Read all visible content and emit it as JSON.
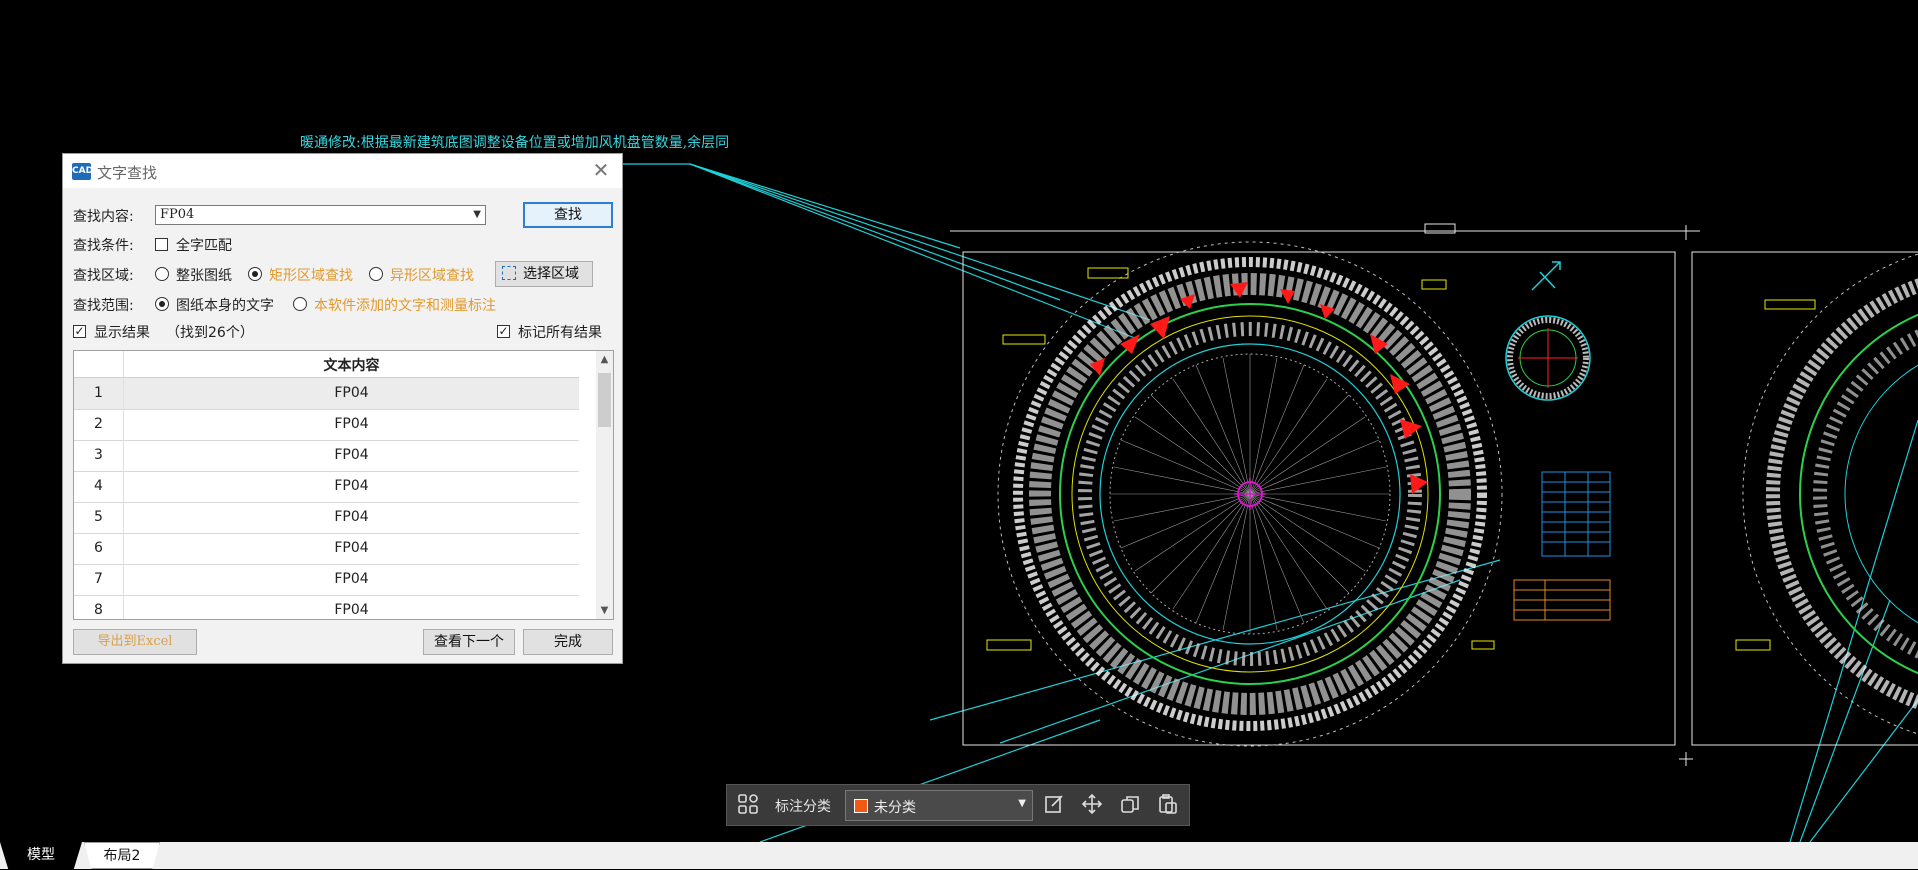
{
  "canvas": {
    "note_text": "暖通修改:根据最新建筑底图调整设备位置或增加风机盘管数量,余层同"
  },
  "dialog": {
    "title": "文字查找",
    "app_icon_text": "CAD",
    "close_glyph": "✕",
    "search_label": "查找内容:",
    "search_value": "FP04",
    "find_button": "查找",
    "condition_label": "查找条件:",
    "whole_word_label": "全字匹配",
    "whole_word_checked": false,
    "area_label": "查找区域:",
    "area_options": [
      "整张图纸",
      "矩形区域查找",
      "异形区域查找"
    ],
    "area_selected": "矩形区域查找",
    "select_area_button": "选择区域",
    "scope_label": "查找范围:",
    "scope_options": [
      "图纸本身的文字",
      "本软件添加的文字和测量标注"
    ],
    "scope_selected": "图纸本身的文字",
    "show_results_label": "显示结果",
    "show_results_checked": true,
    "found_count_text": "（找到26个）",
    "mark_all_label": "标记所有结果",
    "mark_all_checked": true,
    "table": {
      "column_header": "文本内容",
      "rows": [
        {
          "index": "1",
          "text": "FP04"
        },
        {
          "index": "2",
          "text": "FP04"
        },
        {
          "index": "3",
          "text": "FP04"
        },
        {
          "index": "4",
          "text": "FP04"
        },
        {
          "index": "5",
          "text": "FP04"
        },
        {
          "index": "6",
          "text": "FP04"
        },
        {
          "index": "7",
          "text": "FP04"
        },
        {
          "index": "8",
          "text": "FP04"
        }
      ]
    },
    "export_button": "导出到Excel",
    "next_button": "查看下一个",
    "done_button": "完成"
  },
  "annotation_bar": {
    "label": "标注分类",
    "selected_category": "未分类",
    "swatch_color": "#f05a14",
    "icons": [
      "grid-icon",
      "edit-icon",
      "move-icon",
      "copy-icon",
      "paste-icon"
    ]
  },
  "tabs": [
    {
      "label": "模型",
      "active": true
    },
    {
      "label": "布局2",
      "active": false
    }
  ]
}
